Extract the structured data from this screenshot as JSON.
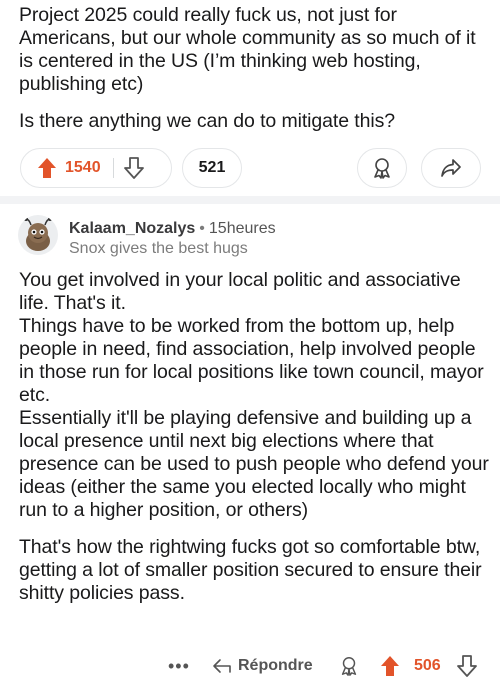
{
  "post": {
    "body": [
      "Project 2025 could really fuck us, not just for Americans, but our whole community as so much of it is centered in the US (I’m thinking web hosting, publishing etc)",
      "Is there anything we can do to mitigate this?"
    ],
    "votes": "1540",
    "comments": "521"
  },
  "comment": {
    "username": "Kalaam_Nozalys",
    "separator": "•",
    "time": "15heures",
    "flair": "Snox gives the best hugs",
    "paragraph1_lines": [
      "You get involved in your local politic and associative life. That's it.",
      "Things have to be worked from the bottom up, help people in need, find  association, help involved people in those run for local positions like town council, mayor etc.",
      "Essentially it'll be playing defensive and building up a local presence until next big elections where that presence can be used to push people who defend your ideas (either the same you elected locally who might run to a higher position, or others)"
    ],
    "paragraph2": "That's how the rightwing fucks got so comfortable btw, getting a lot of smaller position secured to ensure their shitty policies pass.",
    "more": "•••",
    "reply_label": "Répondre",
    "votes": "506"
  },
  "icons": {
    "upvote": "upvote-arrow-icon",
    "downvote": "downvote-arrow-icon",
    "award": "award-icon",
    "share": "share-icon",
    "reply": "reply-arrow-icon",
    "avatar": "snoo-avatar"
  },
  "colors": {
    "upvote_accent": "#e2542a",
    "divider": "#f2f3f5"
  }
}
